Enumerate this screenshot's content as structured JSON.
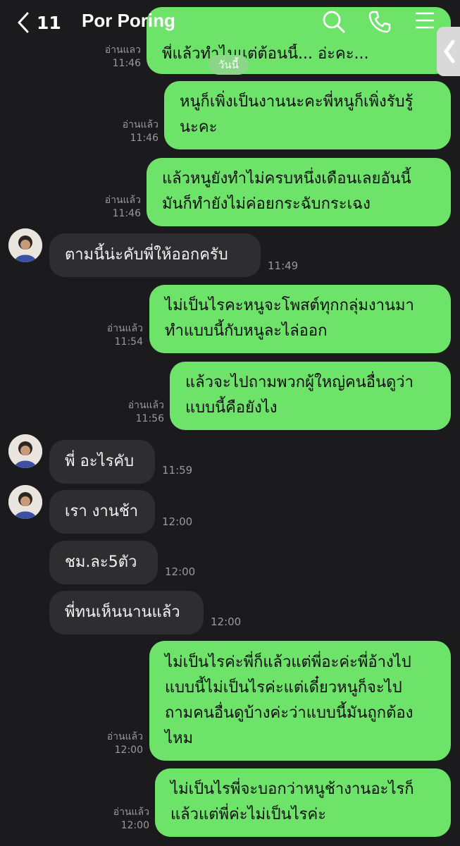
{
  "header": {
    "back_count": "11",
    "contact_name": "Por Poring"
  },
  "day_separator": "วันนี้",
  "messages": [
    {
      "text": "...พี่แล้วทำไมแต่ต้อนนี้... อ่ะคะ",
      "read": "อ่านแลว",
      "time": "11:46"
    },
    {
      "line1": "หนูก็เพิ่งเป็นงานนะคะพี่หนูก็เพิ่งรับรู้",
      "line2": "นะคะ",
      "read": "อ่านแล้ว",
      "time": "11:46"
    },
    {
      "line1": "แล้วหนูยังทำไม่ครบหนึ่งเดือนเลยอันนี้",
      "line2": "มันก็ทำยังไม่ค่อยกระฉับกระเฉง",
      "read": "อ่านแล้ว",
      "time": "11:46"
    },
    {
      "text": "ตามนี้น่ะคับพี่ให้ออกครับ",
      "time": "11:49"
    },
    {
      "line1": "ไม่เป็นไรคะหนูจะโพสต์ทุกกลุ่มงานมา",
      "line2": "ทำแบบนี้กับหนูละไล่ออก",
      "read": "อ่านแล้ว",
      "time": "11:54"
    },
    {
      "line1": "แล้วจะไปถามพวกผู้ใหญ่คนอื่นดูว่า",
      "line2": "แบบนี้คือยังไง",
      "read": "อ่านแล้ว",
      "time": "11:56"
    },
    {
      "text": "พี่ อะไรคับ",
      "time": "11:59"
    },
    {
      "text": "เรา งานช้า",
      "time": "12:00"
    },
    {
      "text": "ชม.ละ5ตัว",
      "time": "12:00"
    },
    {
      "text": "พี่ทนเห็นนานแล้ว",
      "time": "12:00"
    },
    {
      "line1": "ไม่เป็นไรค่ะพี่ก็แล้วแต่พี่อะค่ะพี่อ้างไป",
      "line2": "แบบนี้ไม่เป็นไรค่ะแต่เดี๋ยวหนูก็จะไป",
      "line3": "ถามคนอื่นดูบ้างค่ะว่าแบบนี้มันถูกต้อง",
      "line4": "ไหม",
      "read": "อ่านแล้ว",
      "time": "12:00"
    },
    {
      "line1": "ไม่เป็นไรพี่จะบอกว่าหนูช้างานอะไรก็",
      "line2": "แล้วแต่พี่ค่ะไม่เป็นไรค่ะ",
      "read": "อ่านแล้ว",
      "time": "12:00"
    }
  ],
  "colors": {
    "background": "#1b1b1d",
    "outgoing": "#6ee36a",
    "incoming": "#2e2e31"
  }
}
